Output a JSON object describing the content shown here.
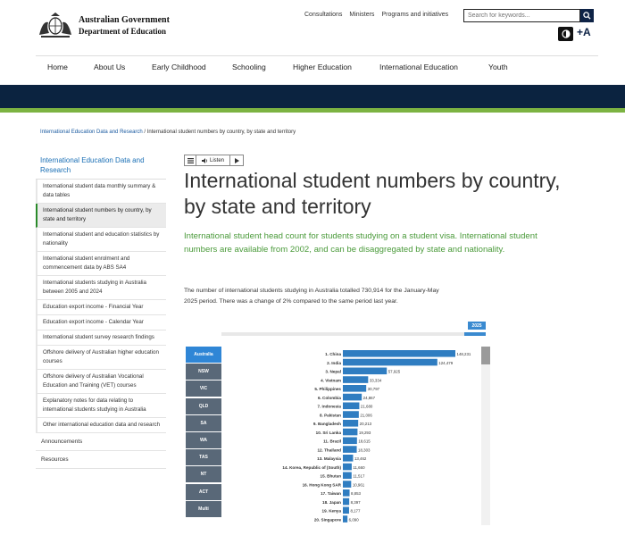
{
  "header": {
    "gov_line1": "Australian Government",
    "gov_line2": "Department of Education",
    "utility_links": [
      "Consultations",
      "Ministers",
      "Programs and initiatives"
    ],
    "search_placeholder": "Search for keywords...",
    "text_size_label": "+A",
    "nav": [
      "Home",
      "About Us",
      "Early Childhood",
      "Schooling",
      "Higher Education",
      "International Education",
      "Youth"
    ]
  },
  "colors": {
    "navy": "#0b2340",
    "green": "#7cb342",
    "link_blue": "#1a6fb5",
    "lead_green": "#4a9a3a",
    "bar_blue": "#2f7dc1",
    "state_grey": "#596878",
    "state_active": "#2f86d6"
  },
  "breadcrumb": {
    "parent": "International Education Data and Research",
    "separator": "/",
    "current": "International student numbers by country, by state and territory"
  },
  "sidebar": {
    "heading": "International Education Data and Research",
    "items": [
      {
        "label": "International student data monthly summary & data tables",
        "active": false
      },
      {
        "label": "International student numbers by country, by state and territory",
        "active": true
      },
      {
        "label": "International student and education statistics by nationality",
        "active": false
      },
      {
        "label": "International student enrolment and commencement data by ABS SA4",
        "active": false
      },
      {
        "label": "International students studying in Australia between 2005 and 2024",
        "active": false
      },
      {
        "label": "Education export income - Financial Year",
        "active": false
      },
      {
        "label": "Education export income - Calendar Year",
        "active": false
      },
      {
        "label": "International student survey research findings",
        "active": false
      },
      {
        "label": "Offshore delivery of Australian higher education courses",
        "active": false
      },
      {
        "label": "Offshore delivery of Australian Vocational Education and Training (VET) courses",
        "active": false
      },
      {
        "label": "Explanatory notes for data relating to international students studying in Australia",
        "active": false
      },
      {
        "label": "Other international education data and research",
        "active": false
      }
    ],
    "extra": [
      "Announcements",
      "Resources"
    ]
  },
  "listen": {
    "label": "Listen",
    "menu_icon": "menu-icon",
    "play_icon": "play-icon"
  },
  "main": {
    "title": "International student numbers by country, by state and territory",
    "lead": "International student head count for students studying on a student visa. International student numbers are available from 2002, and can be disaggregated by state and nationality.",
    "body": "The number of international students studying in Australia totalled 730,914 for the January-May 2025 period. There was a change of 2% compared to the same period last year."
  },
  "dashboard": {
    "year": "2025",
    "states": [
      "Australia",
      "NSW",
      "VIC",
      "QLD",
      "SA",
      "WA",
      "TAS",
      "NT",
      "ACT",
      "Multi"
    ],
    "active_state": "Australia"
  },
  "chart_data": {
    "type": "bar",
    "orientation": "horizontal",
    "categories": [
      "1. China",
      "2. India",
      "3. Nepal",
      "4. Vietnam",
      "5. Philippines",
      "6. Colombia",
      "7. Indonesia",
      "8. Pakistan",
      "9. Bangladesh",
      "10. Sri Lanka",
      "11. Brazil",
      "12. Thailand",
      "13. Malaysia",
      "14. Korea, Republic of (South)",
      "15. Bhutan",
      "16. Hong Kong SAR",
      "17. Taiwan",
      "18. Japan",
      "19. Kenya",
      "20. Singapore"
    ],
    "values": [
      148231,
      124479,
      57925,
      33334,
      30797,
      24867,
      21680,
      21006,
      20213,
      19293,
      18615,
      18303,
      13462,
      11660,
      11517,
      10961,
      8853,
      8397,
      8177,
      6090
    ],
    "value_labels": [
      "148,231",
      "124,479",
      "57,925",
      "33,334",
      "30,797",
      "24,867",
      "21,680",
      "21,006",
      "20,213",
      "19,293",
      "18,615",
      "18,303",
      "13,462",
      "11,660",
      "11,517",
      "10,961",
      "8,853",
      "8,397",
      "8,177",
      "6,090"
    ],
    "title": "",
    "xlabel": "",
    "ylabel": ""
  }
}
